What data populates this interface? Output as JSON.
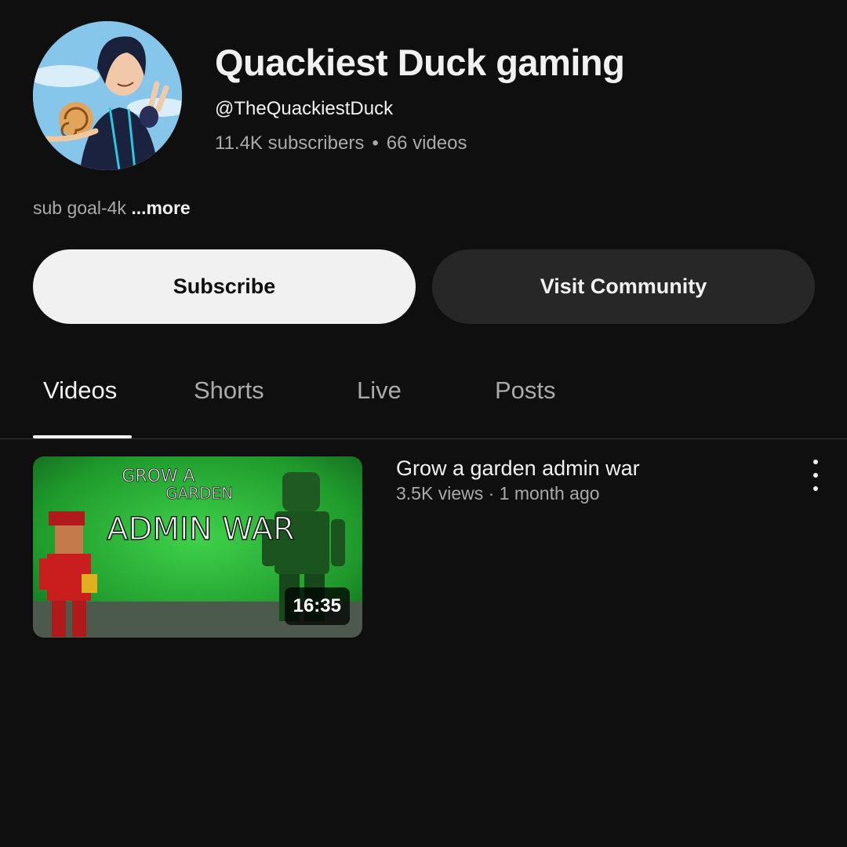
{
  "channel": {
    "name": "Quackiest Duck gaming",
    "handle": "@TheQuackiestDuck",
    "subscribers": "11.4K subscribers",
    "videos_count": "66 videos",
    "separator": "•",
    "description": "sub goal-4k",
    "more_label": "...more"
  },
  "actions": {
    "subscribe_label": "Subscribe",
    "community_label": "Visit Community"
  },
  "tabs": [
    {
      "label": "Videos",
      "active": true
    },
    {
      "label": "Shorts",
      "active": false
    },
    {
      "label": "Live",
      "active": false
    },
    {
      "label": "Posts",
      "active": false
    }
  ],
  "video": {
    "title": "Grow a garden admin war",
    "meta": "3.5K views · 1 month ago",
    "duration": "16:35",
    "thumbnail_text": {
      "grow": "GROW A",
      "garden": "GARDEN",
      "headline": "ADMIN WAR"
    }
  },
  "colors": {
    "background": "#0f0f0f",
    "subscribe_bg": "#f1f1f1",
    "community_bg": "#272727",
    "muted_text": "#aaaaaa",
    "thumbnail_green": "#2db838"
  }
}
